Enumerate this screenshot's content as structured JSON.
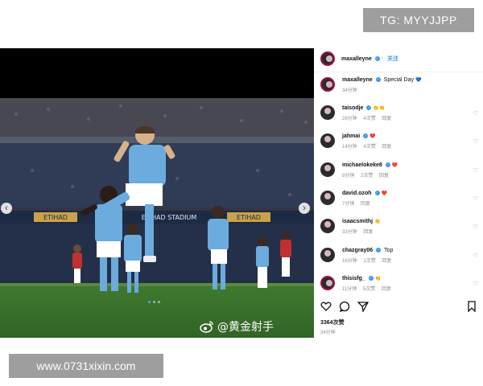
{
  "watermarks": {
    "top": "TG: MYYJJPP",
    "bottom": "www.0731xixin.com"
  },
  "media": {
    "stadium_banner": "ETIHAD",
    "stadium_sign": "ETIHAD STADIUM",
    "weibo_credit": "@黄金射手",
    "nav_prev": "‹",
    "nav_next": "›",
    "slide_count": 3,
    "active_slide": 1
  },
  "post": {
    "author": "maxalleyne",
    "verified": true,
    "follow_label": "关注",
    "likes": "3364次赞",
    "time": "34分钟"
  },
  "comments": [
    {
      "user": "maxalleyne",
      "text": "Special Day",
      "emoji": "💙",
      "time": "34分钟",
      "likes": "",
      "reply": ""
    },
    {
      "user": "taisodje",
      "text": "",
      "emoji": "👏👏",
      "time": "28分钟",
      "likes": "4次赞",
      "reply": "回复"
    },
    {
      "user": "jahmai",
      "text": "",
      "emoji": "❤️",
      "time": "14分钟",
      "likes": "4次赞",
      "reply": "回复"
    },
    {
      "user": "michaelokeke8",
      "text": "",
      "emoji": "❤️",
      "time": "8分钟",
      "likes": "2次赞",
      "reply": "回复"
    },
    {
      "user": "david.ozoh",
      "text": "",
      "emoji": "❤️",
      "time": "7分钟",
      "likes": "",
      "reply": "回复"
    },
    {
      "user": "isaacsmithj",
      "text": "",
      "emoji": "👏",
      "time": "33分钟",
      "likes": "",
      "reply": "回复"
    },
    {
      "user": "chazgray06",
      "text": "Top",
      "emoji": "",
      "time": "16分钟",
      "likes": "1次赞",
      "reply": "回复"
    },
    {
      "user": "thisisfg_",
      "text": "",
      "emoji": "👏",
      "time": "11分钟",
      "likes": "5次赞",
      "reply": "回复"
    }
  ],
  "colors": {
    "accent": "#3797f0",
    "sky_blue": "#6cabdd",
    "watermark_bg": "#9e9e9e"
  }
}
